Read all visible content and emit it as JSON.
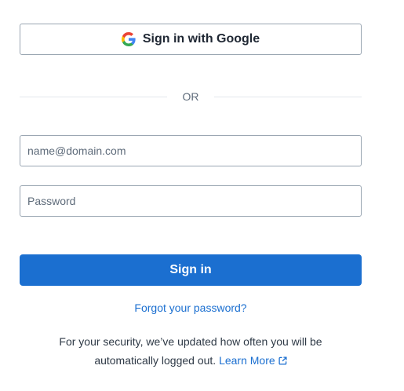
{
  "google_button": {
    "label": "Sign in with Google",
    "icon": "google-icon"
  },
  "divider": {
    "label": "OR"
  },
  "email": {
    "value": "",
    "placeholder": "name@domain.com"
  },
  "password": {
    "value": "",
    "placeholder": "Password"
  },
  "sign_in_button": {
    "label": "Sign in"
  },
  "forgot_link": {
    "label": "Forgot your password?"
  },
  "notice": {
    "line1": "For your security, we’ve updated how often you will be",
    "line2": "automatically logged out.",
    "link_label": "Learn More",
    "link_icon": "external-link-icon"
  },
  "colors": {
    "primary": "#1b6fd0",
    "border": "#9aa6b2",
    "text": "#1f2733",
    "muted": "#5e6b7a"
  }
}
